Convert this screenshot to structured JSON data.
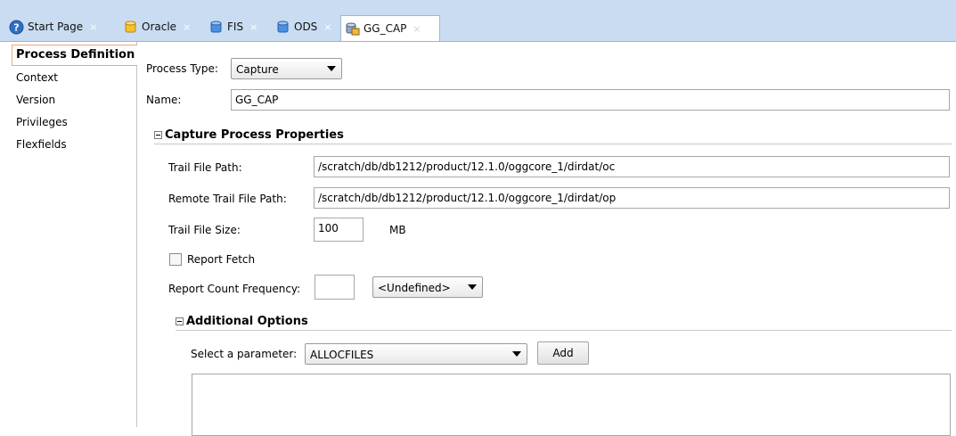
{
  "tabs": [
    {
      "label": "Start Page",
      "icon": "help-icon"
    },
    {
      "label": "Oracle",
      "icon": "database-icon"
    },
    {
      "label": "FIS",
      "icon": "database-icon"
    },
    {
      "label": "ODS",
      "icon": "database-icon"
    },
    {
      "label": "GG_CAP",
      "icon": "capture-process-icon",
      "active": true
    }
  ],
  "close_glyph": "×",
  "nav": {
    "items": [
      "Process Definition",
      "Context",
      "Version",
      "Privileges",
      "Flexfields"
    ],
    "selected": "Process Definition"
  },
  "form": {
    "process_type_label": "Process Type:",
    "process_type_value": "Capture",
    "name_label": "Name:",
    "name_value": "GG_CAP",
    "capture_section": "Capture Process Properties",
    "trail_file_path_label": "Trail File Path:",
    "trail_file_path_value": "/scratch/db/db1212/product/12.1.0/oggcore_1/dirdat/oc",
    "remote_trail_label": "Remote Trail File Path:",
    "remote_trail_value": "/scratch/db/db1212/product/12.1.0/oggcore_1/dirdat/op",
    "trail_size_label": "Trail File Size:",
    "trail_size_value": "100",
    "trail_size_unit": "MB",
    "report_fetch_label": "Report Fetch",
    "report_fetch_checked": false,
    "report_count_label": "Report Count Frequency:",
    "report_count_value": "",
    "report_count_unit": "<Undefined>",
    "additional_section": "Additional Options",
    "select_param_label": "Select a parameter:",
    "select_param_value": "ALLOCFILES",
    "add_label": "Add"
  },
  "colors": {
    "tabbar": "#c9dcf2",
    "selection_border": "#f2a77a"
  }
}
